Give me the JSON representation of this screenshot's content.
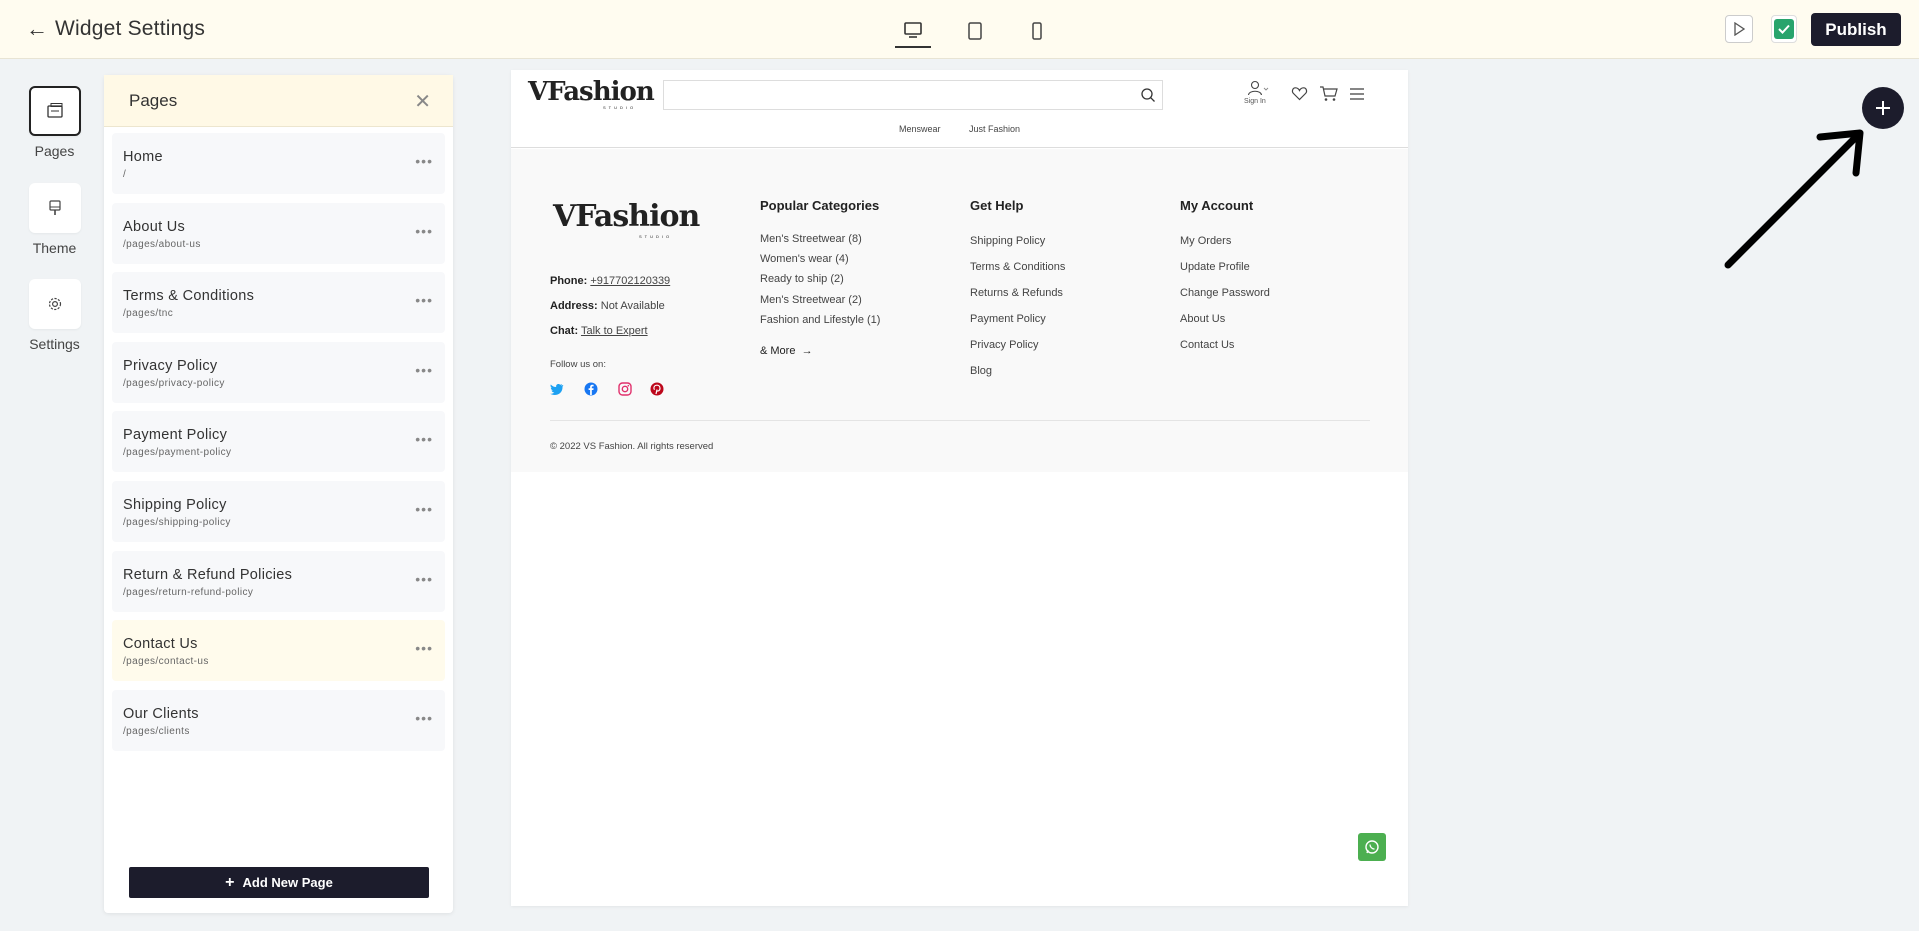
{
  "topbar": {
    "title": "Widget Settings",
    "devices": [
      "desktop-icon",
      "tablet-icon",
      "mobile-icon"
    ],
    "active_device": "desktop",
    "publish_label": "Publish"
  },
  "rail": {
    "items": [
      {
        "label": "Pages",
        "icon": "pages-icon",
        "active": true
      },
      {
        "label": "Theme",
        "icon": "theme-icon",
        "active": false
      },
      {
        "label": "Settings",
        "icon": "gear-icon",
        "active": false
      }
    ]
  },
  "pages_panel": {
    "title": "Pages",
    "items": [
      {
        "name": "Home",
        "path": "/"
      },
      {
        "name": "About Us",
        "path": "/pages/about-us"
      },
      {
        "name": "Terms & Conditions",
        "path": "/pages/tnc"
      },
      {
        "name": "Privacy Policy",
        "path": "/pages/privacy-policy"
      },
      {
        "name": "Payment Policy",
        "path": "/pages/payment-policy"
      },
      {
        "name": "Shipping Policy",
        "path": "/pages/shipping-policy"
      },
      {
        "name": "Return & Refund Policies",
        "path": "/pages/return-refund-policy"
      },
      {
        "name": "Contact Us",
        "path": "/pages/contact-us"
      },
      {
        "name": "Our Clients",
        "path": "/pages/clients"
      }
    ],
    "more_glyph": "•••",
    "add_label": "Add New Page"
  },
  "preview": {
    "logo": "VFashion",
    "logo_sub": "STUDIO",
    "signin_label": "Sign In",
    "nav": [
      "Menswear",
      "Just Fashion"
    ],
    "footer": {
      "phone_label": "Phone:",
      "phone": "+917702120339",
      "address_label": "Address:",
      "address": "Not Available",
      "chat_label": "Chat:",
      "chat": "Talk to Expert",
      "follow": "Follow us on:",
      "popular_title": "Popular Categories",
      "popular": [
        "Men's Streetwear (8)",
        "Women's wear (4)",
        "Ready to ship (2)",
        "Men's Streetwear (2)",
        "Fashion and Lifestyle (1)"
      ],
      "more_label": "& More",
      "help_title": "Get Help",
      "help": [
        "Shipping Policy",
        "Terms & Conditions",
        "Returns & Refunds",
        "Payment Policy",
        "Privacy Policy",
        "Blog"
      ],
      "account_title": "My Account",
      "account": [
        "My Orders",
        "Update Profile",
        "Change Password",
        "About Us",
        "Contact Us"
      ],
      "copyright": "© 2022 VS Fashion. All rights reserved"
    }
  },
  "colors": {
    "topbar_bg": "#fffcf0",
    "dark": "#1c1c2c",
    "accent_green": "#28a46c",
    "whatsapp": "#4caf50"
  }
}
